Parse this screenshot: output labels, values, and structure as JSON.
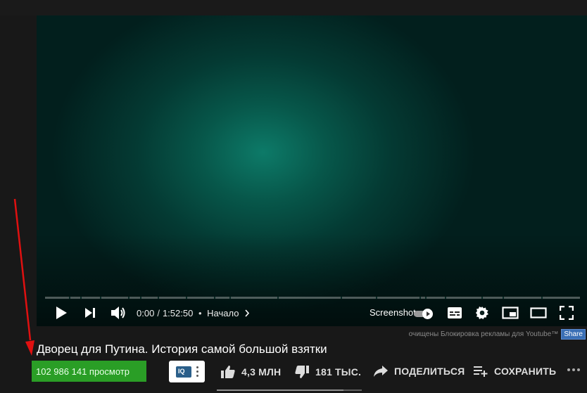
{
  "player": {
    "time_current": "0:00",
    "time_separator": "/",
    "time_total": "1:52:50",
    "bullet": "•",
    "chapter_label": "Начало",
    "screenshot_label": "Screenshot",
    "progress_fraction": 0
  },
  "adblock": {
    "notice": "очищены Блокировка рекламы для Youtube™",
    "share_label": "Share"
  },
  "video": {
    "title": "Дворец для Путина. История самой большой взятки",
    "views": "102 986 141 просмотр"
  },
  "actions": {
    "likes": "4,3 МЛН",
    "dislikes": "181 ТЫС.",
    "share": "ПОДЕЛИТЬСЯ",
    "save": "СОХРАНИТЬ"
  },
  "extension": {
    "logo_text": "IQ"
  },
  "colors": {
    "views_badge": "#2a9e26",
    "annotation_arrow": "#e01010",
    "player_glow": "#0d7a68"
  },
  "icons": {
    "play": "play-icon",
    "next": "next-icon",
    "volume": "volume-icon",
    "subtitles": "subtitles-icon",
    "settings": "gear-icon",
    "miniplayer": "miniplayer-icon",
    "theater": "theater-icon",
    "fullscreen": "fullscreen-icon"
  }
}
